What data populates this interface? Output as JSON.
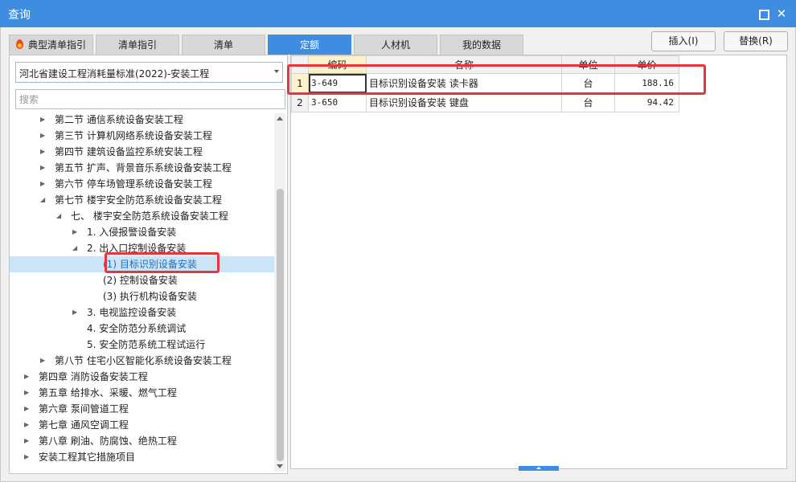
{
  "window": {
    "title": "查询"
  },
  "tabs": [
    {
      "label": "典型清单指引",
      "active": false,
      "icon": "fire-icon"
    },
    {
      "label": "清单指引",
      "active": false
    },
    {
      "label": "清单",
      "active": false
    },
    {
      "label": "定额",
      "active": true
    },
    {
      "label": "人材机",
      "active": false
    },
    {
      "label": "我的数据",
      "active": false
    }
  ],
  "actions": {
    "insert_label": "插入(I)",
    "replace_label": "替换(R)"
  },
  "left": {
    "library_selected": "河北省建设工程消耗量标准(2022)-安装工程",
    "search_placeholder": "搜索",
    "tree": [
      {
        "label": "第二节 通信系统设备安装工程",
        "level": 2,
        "expander": "collapsed"
      },
      {
        "label": "第三节 计算机网络系统设备安装工程",
        "level": 2,
        "expander": "collapsed"
      },
      {
        "label": "第四节 建筑设备监控系统安装工程",
        "level": 2,
        "expander": "collapsed"
      },
      {
        "label": "第五节 扩声、背景音乐系统设备安装工程",
        "level": 2,
        "expander": "collapsed"
      },
      {
        "label": "第六节 停车场管理系统设备安装工程",
        "level": 2,
        "expander": "collapsed"
      },
      {
        "label": "第七节 楼宇安全防范系统设备安装工程",
        "level": 2,
        "expander": "expanded"
      },
      {
        "label": "七、 楼宇安全防范系统设备安装工程",
        "level": 3,
        "expander": "expanded"
      },
      {
        "label": "1. 入侵报警设备安装",
        "level": 4,
        "expander": "collapsed"
      },
      {
        "label": "2. 出入口控制设备安装",
        "level": 4,
        "expander": "expanded"
      },
      {
        "label": "(1) 目标识别设备安装",
        "level": 5,
        "expander": "none",
        "selected": true
      },
      {
        "label": "(2) 控制设备安装",
        "level": 5,
        "expander": "none"
      },
      {
        "label": "(3) 执行机构设备安装",
        "level": 5,
        "expander": "none"
      },
      {
        "label": "3. 电视监控设备安装",
        "level": 4,
        "expander": "collapsed"
      },
      {
        "label": "4. 安全防范分系统调试",
        "level": 4,
        "expander": "none"
      },
      {
        "label": "5. 安全防范系统工程试运行",
        "level": 4,
        "expander": "none"
      },
      {
        "label": "第八节 住宅小区智能化系统设备安装工程",
        "level": 2,
        "expander": "collapsed"
      },
      {
        "label": "第四章 消防设备安装工程",
        "level": 1,
        "expander": "collapsed"
      },
      {
        "label": "第五章 给排水、采暖、燃气工程",
        "level": 1,
        "expander": "collapsed"
      },
      {
        "label": "第六章 泵间管道工程",
        "level": 1,
        "expander": "collapsed"
      },
      {
        "label": "第七章 通风空调工程",
        "level": 1,
        "expander": "collapsed"
      },
      {
        "label": "第八章 刷油、防腐蚀、绝热工程",
        "level": 1,
        "expander": "collapsed"
      },
      {
        "label": "安装工程其它措施项目",
        "level": 1,
        "expander": "collapsed"
      }
    ]
  },
  "grid": {
    "columns": [
      "编码",
      "名称",
      "单位",
      "单价"
    ],
    "rows": [
      {
        "num": "1",
        "code": "3-649",
        "name": "目标识别设备安装 读卡器",
        "unit": "台",
        "price": "188.16",
        "current": true
      },
      {
        "num": "2",
        "code": "3-650",
        "name": "目标识别设备安装 键盘",
        "unit": "台",
        "price": "94.42",
        "current": false
      }
    ]
  },
  "colors": {
    "accent": "#3e8de1",
    "annotation": "#e8343a",
    "selected_row": "#cce4f7"
  }
}
